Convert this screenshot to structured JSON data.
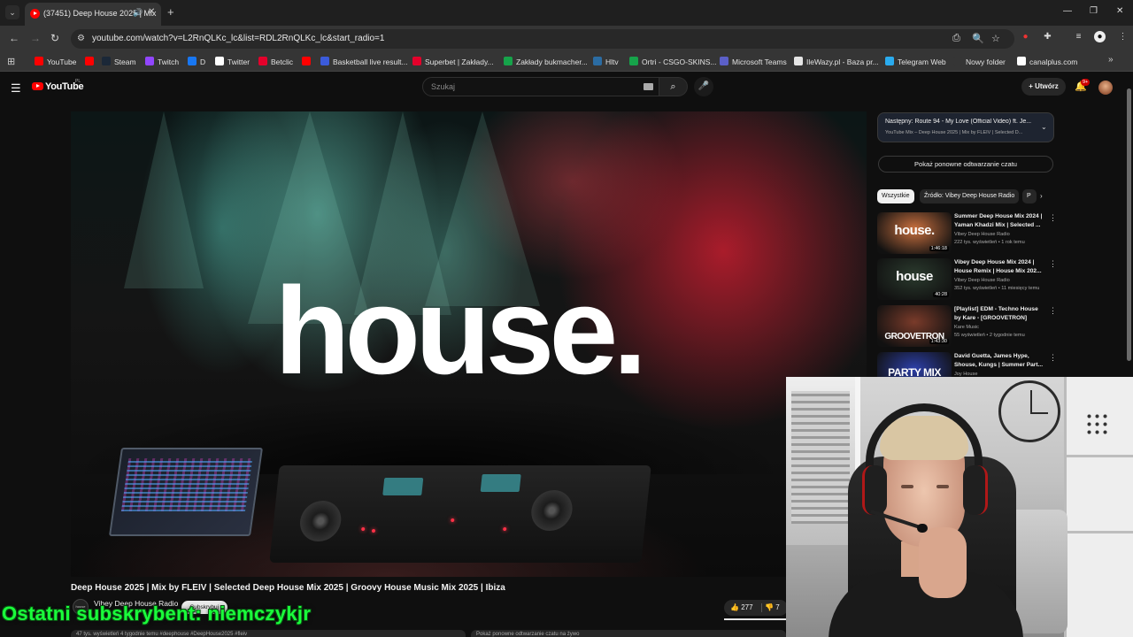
{
  "browser": {
    "tab": {
      "title": "(37451) Deep House 2025 | Mix",
      "audio_icon": "speaker-icon",
      "close_icon": "close-icon"
    },
    "address_url": "youtube.com/watch?v=L2RnQLKc_lc&list=RDL2RnQLKc_lc&start_radio=1",
    "bookmarks": [
      {
        "label": "YouTube",
        "color": "#ff0000"
      },
      {
        "label": "",
        "color": "#ff0000"
      },
      {
        "label": "Steam",
        "color": "#1b2838"
      },
      {
        "label": "Twitch",
        "color": "#9146ff"
      },
      {
        "label": "D",
        "color": "#1877f2"
      },
      {
        "label": "Twitter",
        "color": "#ffffff"
      },
      {
        "label": "Betclic",
        "color": "#e4002b"
      },
      {
        "label": "",
        "color": "#ff0000"
      },
      {
        "label": "Basketball live result...",
        "color": "#3b5bdb"
      },
      {
        "label": "Superbet | Zakłady...",
        "color": "#e4002b"
      },
      {
        "label": "Zakłady bukmacher...",
        "color": "#16a34a"
      },
      {
        "label": "Hltv",
        "color": "#2b6ca3"
      },
      {
        "label": "Ortri - CSGO-SKINS...",
        "color": "#16a34a"
      },
      {
        "label": "Microsoft Teams",
        "color": "#5b5fc7"
      },
      {
        "label": "IleWazy.pl - Baza pr...",
        "color": "#e5e5e5"
      },
      {
        "label": "Telegram Web",
        "color": "#2aabee"
      },
      {
        "label": "Nowy folder",
        "color": "#353535"
      },
      {
        "label": "canalplus.com",
        "color": "#ffffff"
      }
    ]
  },
  "youtube": {
    "logo_text": "YouTube",
    "country": "PL",
    "search_placeholder": "Szukaj",
    "create_label": "Utwórz",
    "notif_badge": "9+"
  },
  "player": {
    "overlay_word": "house."
  },
  "video": {
    "title": "Deep House 2025 | Mix by FLEIV | Selected Deep House Mix 2025 | Groovy House Music Mix 2025 | Ibiza",
    "channel": "Vibey Deep House Radio",
    "channel_avatar_text": "house",
    "subscribe_label": "Subskrybuj",
    "likes": "277",
    "dislikes": "7",
    "desc_strip": "47 tys. wyświetleń  4 tygodnie temu  #deephouse #DeepHouse2025 #fleiv",
    "chat_strip": "Pokaż ponowne odtwarzanie czatu na żywo"
  },
  "overlay": {
    "last_subscriber": "Ostatni subskrybent: niemczykjr"
  },
  "sidebar": {
    "next_title": "Następny: Route 94 - My Love (Official Video) ft. Je...",
    "next_sub": "YouTube Mix – Deep House 2025 | Mix by FLEIV | Selected D...",
    "replay_label": "Pokaż ponowne odtwarzanie czatu",
    "chips": [
      "Wszystkie",
      "Źródło: Vibey Deep House Radio",
      "P"
    ],
    "recs": [
      {
        "title": "Summer Deep House Mix 2024 | Yaman Khadzi Mix | Selected ...",
        "channel": "Vibey Deep House Radio",
        "meta": "222 tys. wyświetleń • 1 rok temu",
        "duration": "1:46:18",
        "thumb_text": "house.",
        "thumb_color": "#c9703f"
      },
      {
        "title": "Vibey Deep House Mix 2024 | House Remix | House Mix 202...",
        "channel": "Vibey Deep House Radio",
        "meta": "352 tys. wyświetleń • 11 miesięcy temu",
        "duration": "40:28",
        "thumb_text": "house",
        "thumb_color": "#2b3b2e"
      },
      {
        "title": "[Playlist] EDM - Techno House by Kare - [GROOVETRON]",
        "channel": "Kare Music",
        "meta": "55 wyświetleń • 2 tygodnie temu",
        "duration": "1:43:30",
        "thumb_text": "GROOVETRON",
        "thumb_color": "#7a3b2a"
      },
      {
        "title": "David Guetta, James Hype, Shouse, Kungs | Summer Part...",
        "channel": "Joy House",
        "meta": "",
        "duration": "",
        "thumb_text": "PARTY MIX",
        "thumb_color": "#2c3fa8"
      }
    ]
  }
}
